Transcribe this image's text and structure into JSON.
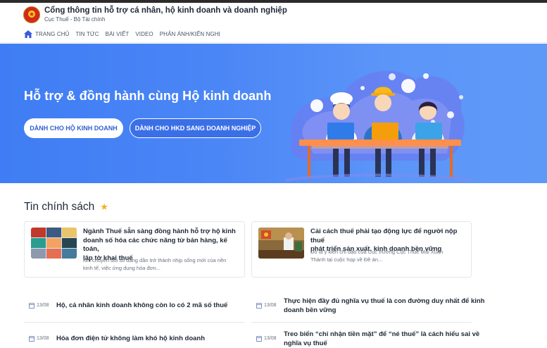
{
  "header": {
    "title": "Cổng thông tin hỗ trợ cá nhân, hộ kinh doanh và doanh nghiệp",
    "subtitle": "Cục Thuế - Bộ Tài chính"
  },
  "nav": {
    "items": [
      "TRANG CHỦ",
      "TIN TỨC",
      "BÀI VIẾT",
      "VIDEO",
      "PHẢN ÁNH/KIẾN NGHỊ"
    ]
  },
  "hero": {
    "title": "Hỗ trợ & đồng hành cùng Hộ kinh doanh",
    "button1": "DÀNH CHO HỘ KINH DOANH",
    "button2": "DÀNH CHO HKD SANG DOANH NGHIỆP"
  },
  "policy": {
    "title": "Tin chính sách",
    "cards": [
      {
        "title_lines": [
          "Ngành Thuế sẵn sàng đồng hành hỗ trợ hộ kinh",
          "doanh số hóa các chức năng từ bán hàng, kế toán,",
          "lập tờ khai thuế"
        ],
        "desc_lines": [
          "Khi chuyển đổi số đang dần trở thành nhịp sống mới của nền",
          "kinh tế, việc ứng dụng hóa đơn..."
        ]
      },
      {
        "title_lines": [
          "Cải cách thuế phải tạo động lực để người nộp thuế",
          "phát triển sản xuất, kinh doanh bền vững"
        ],
        "desc_lines": [
          "Đó là ý kiến chỉ đạo của Cục trưởng Cục Thuế Mai Xuân",
          "Thành tại cuộc họp về Đề án..."
        ]
      }
    ]
  },
  "news": [
    {
      "date": "13/08",
      "title_lines": [
        "Hộ, cá nhân kinh doanh không còn lo có 2 mã số thuế"
      ]
    },
    {
      "date": "13/08",
      "title_lines": [
        "Thực hiện đầy đủ nghĩa vụ thuế là con đường duy nhất để kinh",
        "doanh bền vững"
      ]
    },
    {
      "date": "13/08",
      "title_lines": [
        "Hóa đơn điện tử không làm khó hộ kinh doanh"
      ]
    },
    {
      "date": "13/08",
      "title_lines": [
        "Treo biển “chỉ nhận tiền mặt” để “né thuế” là cách hiểu sai về",
        "nghĩa vụ thuế"
      ]
    }
  ],
  "colors": {
    "hero": "#4b86f6",
    "accent": "#2f5fd0",
    "star": "#f2b01e"
  }
}
